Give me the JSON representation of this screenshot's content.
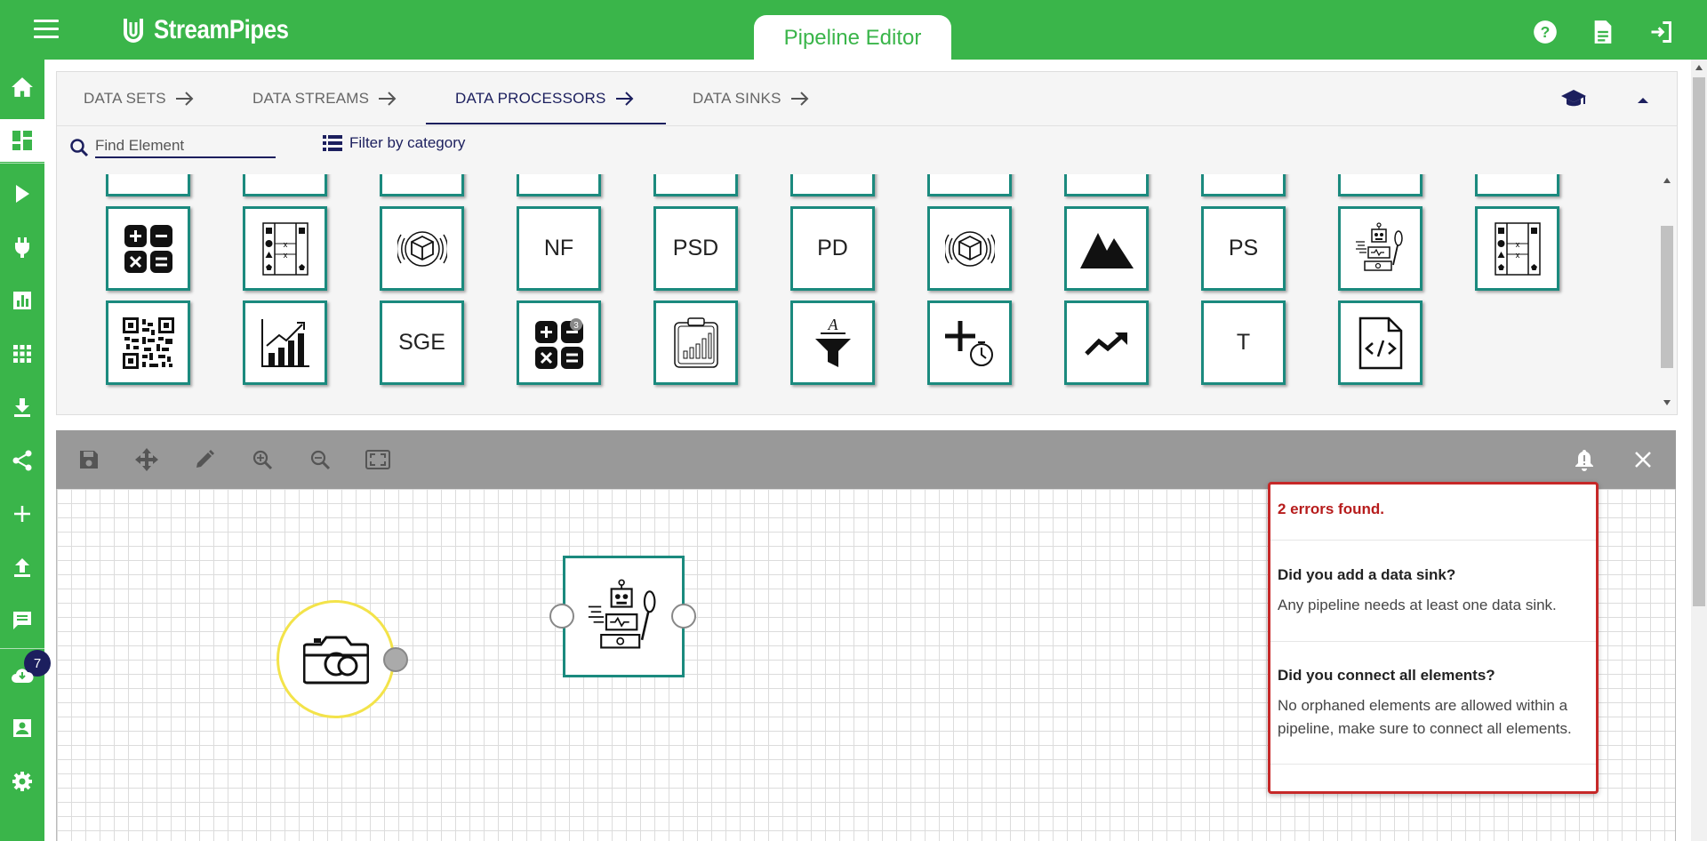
{
  "app": {
    "title": "StreamPipes",
    "active_view": "Pipeline Editor",
    "colors": {
      "primary": "#3ab54a",
      "accent": "#1c1f5e",
      "tile_border": "#1b8a7e",
      "error": "#c62828"
    }
  },
  "header": {
    "icons": [
      "help-icon",
      "docs-icon",
      "logout-icon"
    ]
  },
  "sidebar": {
    "items": [
      {
        "icon": "home-icon"
      },
      {
        "icon": "dashboard-icon",
        "active": true
      },
      {
        "icon": "play-icon"
      },
      {
        "icon": "plug-icon"
      },
      {
        "icon": "bar-chart-icon"
      },
      {
        "icon": "apps-grid-icon"
      },
      {
        "icon": "download-icon"
      },
      {
        "icon": "share-icon"
      },
      {
        "icon": "plus-icon"
      },
      {
        "icon": "upload-icon"
      },
      {
        "icon": "notifications-chat-icon"
      },
      {
        "icon": "cloud-download-icon"
      },
      {
        "icon": "account-icon"
      },
      {
        "icon": "settings-icon"
      }
    ],
    "notification_count": "7"
  },
  "element_panel": {
    "tabs": [
      {
        "label": "DATA SETS"
      },
      {
        "label": "DATA STREAMS"
      },
      {
        "label": "DATA PROCESSORS",
        "active": true
      },
      {
        "label": "DATA SINKS"
      }
    ],
    "search": {
      "placeholder": "Find Element",
      "value": ""
    },
    "filter_label": "Filter by category",
    "tiles_row2": [
      {
        "kind": "icon",
        "icon": "calculator-icon"
      },
      {
        "kind": "icon",
        "icon": "transform-table-icon"
      },
      {
        "kind": "icon",
        "icon": "3d-cube-icon"
      },
      {
        "kind": "text",
        "label": "NF"
      },
      {
        "kind": "text",
        "label": "PSD"
      },
      {
        "kind": "text",
        "label": "PD"
      },
      {
        "kind": "icon",
        "icon": "3d-cube-icon"
      },
      {
        "kind": "icon",
        "icon": "mountains-icon"
      },
      {
        "kind": "text",
        "label": "PS"
      },
      {
        "kind": "icon",
        "icon": "robot-cooking-icon"
      },
      {
        "kind": "icon",
        "icon": "transform-table-icon"
      }
    ],
    "tiles_row3": [
      {
        "kind": "icon",
        "icon": "qr-code-icon"
      },
      {
        "kind": "icon",
        "icon": "growth-chart-icon"
      },
      {
        "kind": "text",
        "label": "SGE"
      },
      {
        "kind": "icon",
        "icon": "calculator-badge-icon",
        "badge": "3"
      },
      {
        "kind": "icon",
        "icon": "clipboard-chart-icon"
      },
      {
        "kind": "icon",
        "icon": "text-filter-icon",
        "letter": "A"
      },
      {
        "kind": "icon",
        "icon": "add-timer-icon"
      },
      {
        "kind": "icon",
        "icon": "trend-up-icon"
      },
      {
        "kind": "text",
        "label": "T"
      },
      {
        "kind": "icon",
        "icon": "code-file-icon"
      }
    ]
  },
  "canvas": {
    "toolbar": [
      "save-icon",
      "move-icon",
      "edit-icon",
      "zoom-in-icon",
      "zoom-out-icon",
      "fit-screen-icon"
    ],
    "toolbar_right": [
      "bell-icon",
      "close-icon"
    ],
    "nodes": [
      {
        "name": "source-node",
        "icon": "camera-icon"
      },
      {
        "name": "processor-node",
        "icon": "robot-cooking-icon"
      }
    ]
  },
  "errors": {
    "summary": "2 errors found.",
    "items": [
      {
        "title": "Did you add a data sink?",
        "text": "Any pipeline needs at least one data sink."
      },
      {
        "title": "Did you connect all elements?",
        "text": "No orphaned elements are allowed within a pipeline, make sure to connect all elements."
      }
    ]
  }
}
